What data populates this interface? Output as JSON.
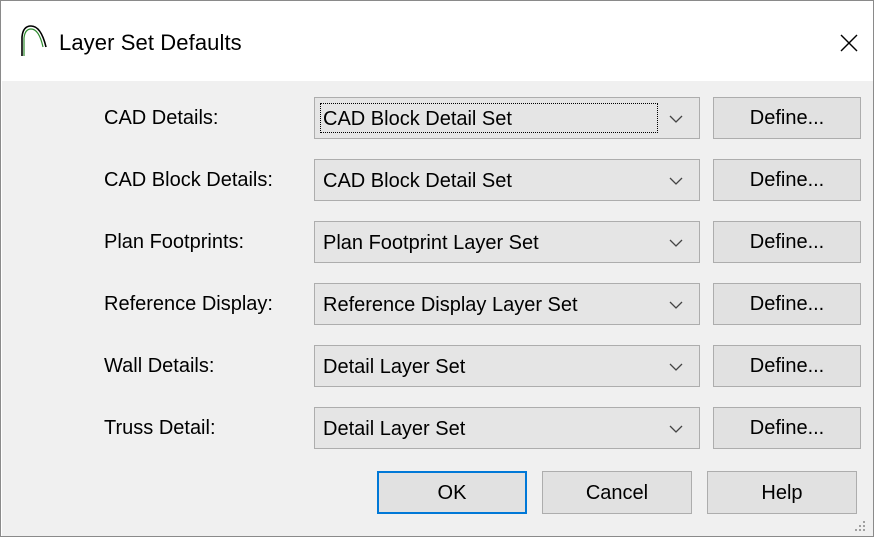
{
  "window": {
    "title": "Layer Set Defaults",
    "close_glyph": "✕",
    "icon": "app-arc-icon"
  },
  "rows": [
    {
      "label": "CAD Details:",
      "value": "CAD Block Detail Set",
      "button": "Define..."
    },
    {
      "label": "CAD Block Details:",
      "value": "CAD Block Detail Set",
      "button": "Define..."
    },
    {
      "label": "Plan Footprints:",
      "value": "Plan Footprint Layer Set",
      "button": "Define..."
    },
    {
      "label": "Reference Display:",
      "value": "Reference Display Layer Set",
      "button": "Define..."
    },
    {
      "label": "Wall Details:",
      "value": "Detail Layer Set",
      "button": "Define..."
    },
    {
      "label": "Truss Detail:",
      "value": "Detail Layer Set",
      "button": "Define..."
    }
  ],
  "footer": {
    "ok_label": "OK",
    "cancel_label": "Cancel",
    "help_label": "Help"
  },
  "colors": {
    "accent": "#0078d7",
    "panel": "#f0f0f0",
    "button": "#e1e1e1",
    "combo": "#e5e5e5"
  }
}
